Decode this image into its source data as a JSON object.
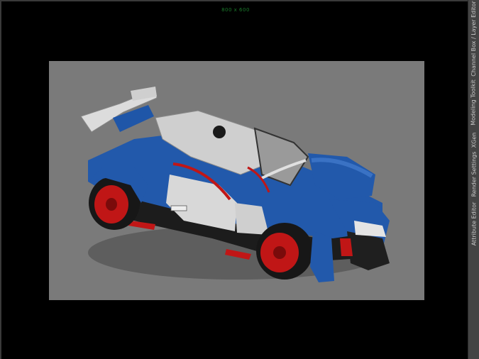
{
  "viewport": {
    "resolution_label": "800 x 600"
  },
  "side_tabs": [
    {
      "label": "Channel Box / Layer Editor"
    },
    {
      "label": "Modeling Toolkit"
    },
    {
      "label": "XGen"
    },
    {
      "label": "Render Settings"
    },
    {
      "label": "Attribute Editor"
    }
  ],
  "colors": {
    "viewport_bg": "#000000",
    "render_region_bg": "#7a7a7a",
    "resolution_label": "#1b7a2b",
    "car_blue": "#1f56a8",
    "car_white": "#d9d9d9",
    "car_red": "#c01616",
    "car_dark": "#1c1c1c"
  }
}
